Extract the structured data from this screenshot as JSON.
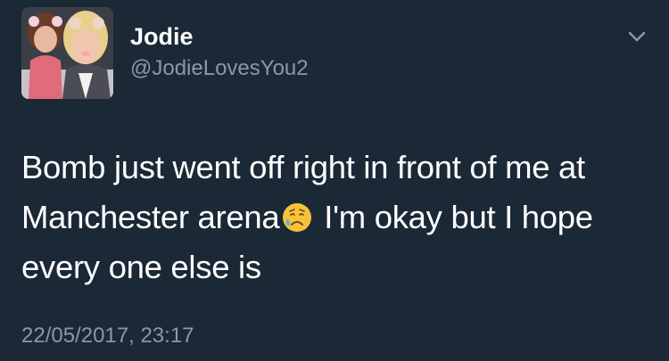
{
  "tweet": {
    "display_name": "Jodie",
    "handle": "@JodieLovesYou2",
    "text_part1": "Bomb just went off right in front of me at Manchester arena",
    "text_part2": " I'm okay but I hope every one else is",
    "emoji_icon": "disappointed-relieved-face-emoji",
    "timestamp": "22/05/2017, 23:17"
  },
  "colors": {
    "background": "#1b2836",
    "primary_text": "#ffffff",
    "secondary_text": "#8899a6"
  },
  "icons": {
    "menu": "chevron-down-icon"
  }
}
